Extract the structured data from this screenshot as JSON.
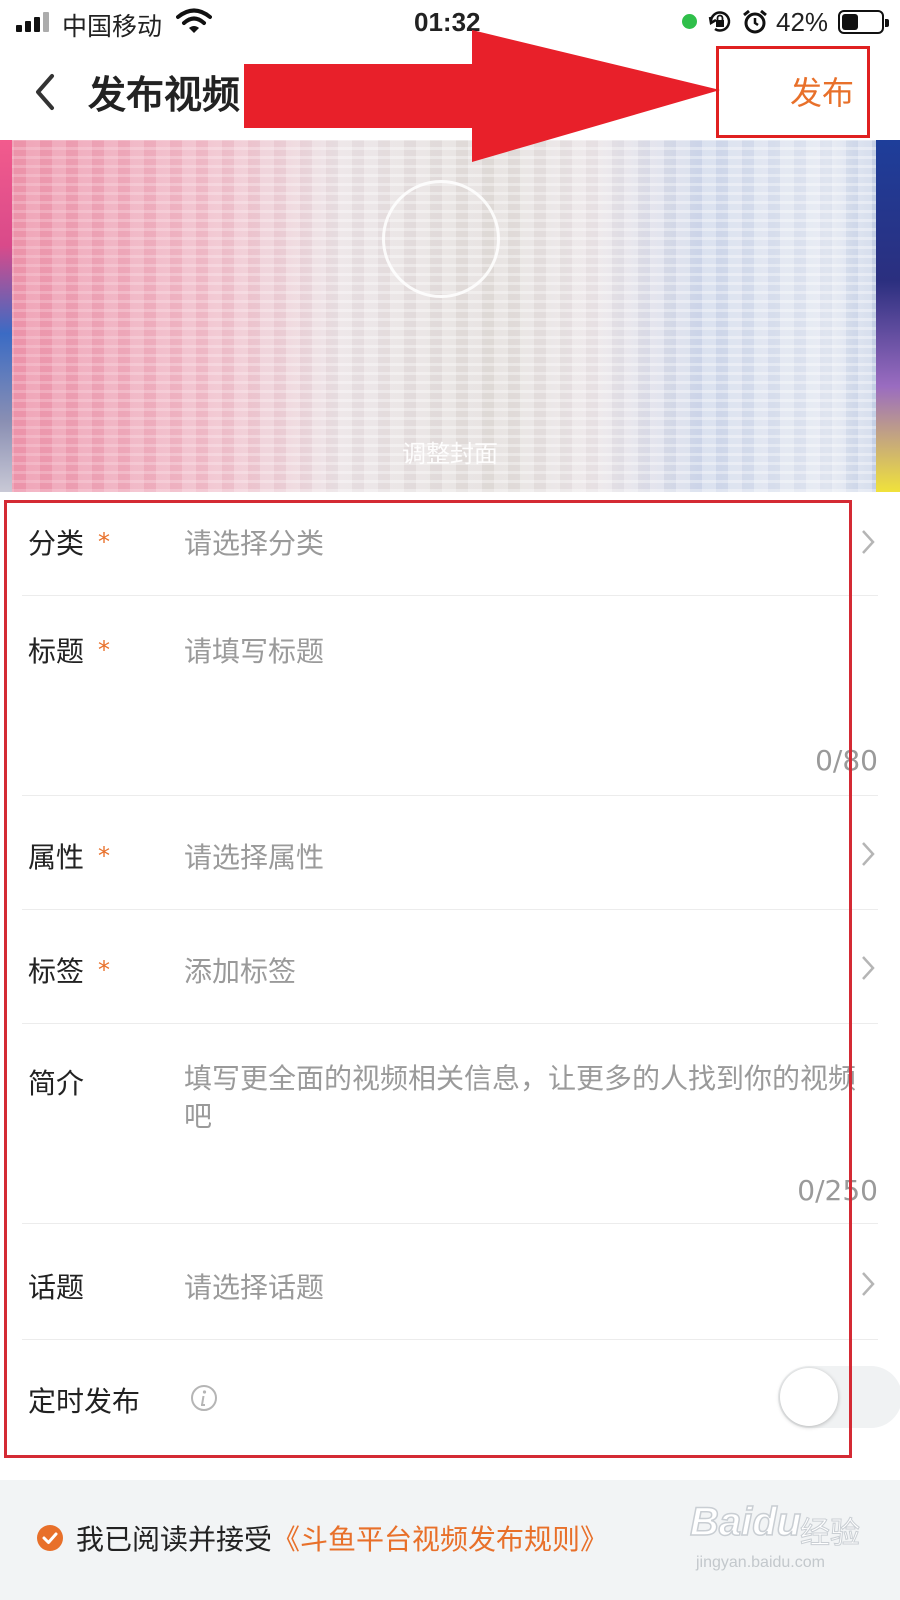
{
  "status_bar": {
    "carrier": "中国移动",
    "time": "01:32",
    "battery": "42%",
    "battery_level": 0.42,
    "icons": [
      "signal-icon",
      "wifi-icon",
      "active-dot-icon",
      "rotation-lock-icon",
      "alarm-icon",
      "battery-icon"
    ]
  },
  "header": {
    "title": "发布视频",
    "publish_label": "发布",
    "back_icon": "chevron-left-icon"
  },
  "cover": {
    "label": "调整封面"
  },
  "form": {
    "category": {
      "label": "分类",
      "required": "*",
      "placeholder": "请选择分类"
    },
    "title": {
      "label": "标题",
      "required": "*",
      "placeholder": "请填写标题",
      "count": "0/80"
    },
    "attribute": {
      "label": "属性",
      "required": "*",
      "placeholder": "请选择属性"
    },
    "tags": {
      "label": "标签",
      "required": "*",
      "placeholder": "添加标签"
    },
    "description": {
      "label": "简介",
      "placeholder": "填写更全面的视频相关信息，让更多的人找到你的视频吧",
      "count": "0/250"
    },
    "topic": {
      "label": "话题",
      "placeholder": "请选择话题"
    },
    "scheduled": {
      "label": "定时发布",
      "enabled": false
    }
  },
  "footer": {
    "agree_text": "我已阅读并接受",
    "rules_link": "《斗鱼平台视频发布规则》"
  },
  "watermark": {
    "logo": "Baidu",
    "logo_suffix": "经验",
    "url": "jingyan.baidu.com"
  },
  "colors": {
    "accent": "#e8702a",
    "annotation_red": "#e02020",
    "placeholder": "#9a9a9a"
  }
}
